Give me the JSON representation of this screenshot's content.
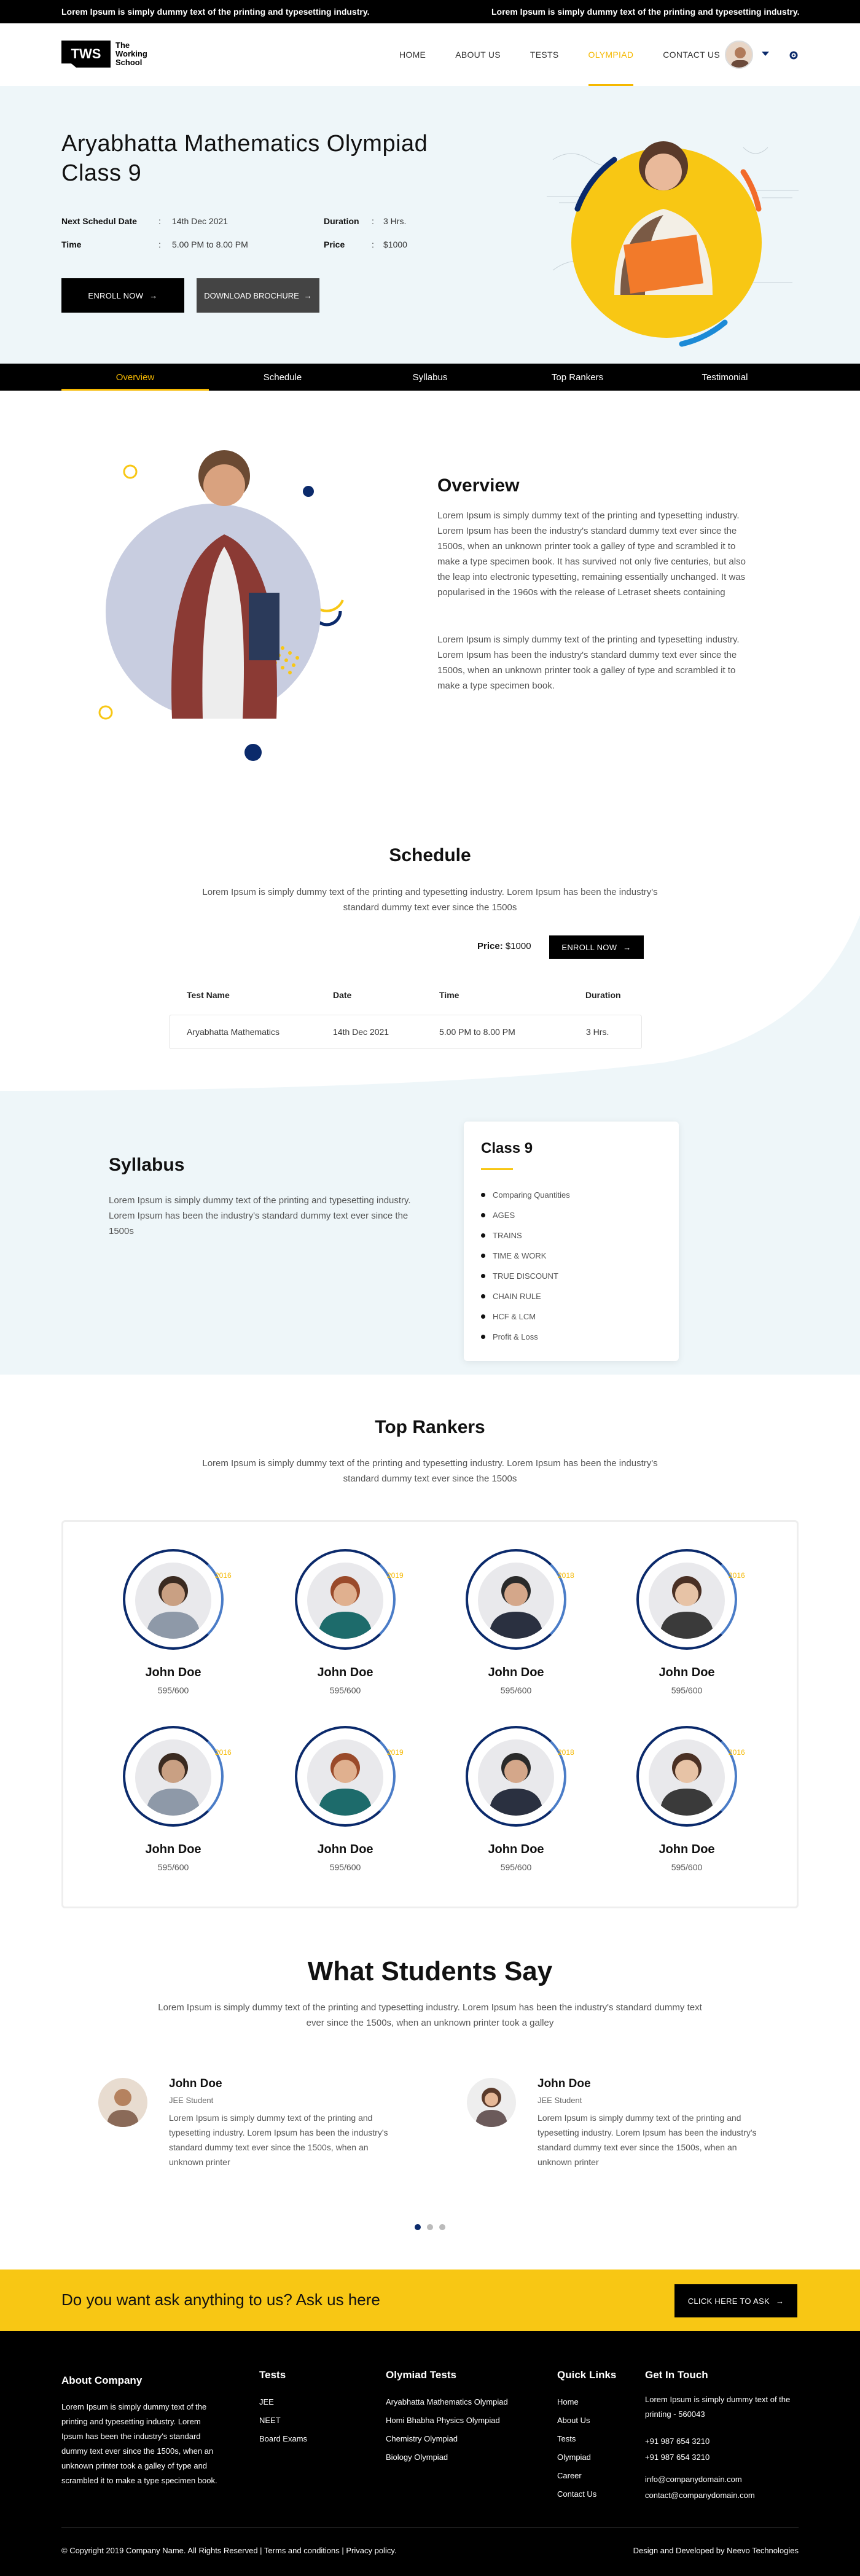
{
  "ticker": {
    "text": "Lorem Ipsum is simply dummy text of the printing and typesetting industry."
  },
  "header": {
    "logo_mark": "TWS",
    "logo_line1": "The",
    "logo_line2": "Working",
    "logo_line3": "School",
    "nav": [
      "HOME",
      "ABOUT US",
      "TESTS",
      "OLYMPIAD",
      "CONTACT US"
    ],
    "active_nav": "OLYMPIAD"
  },
  "hero": {
    "title": "Aryabhatta Mathematics Olympiad Class 9",
    "next_label": "Next Schedul Date",
    "next_value": "14th Dec 2021",
    "duration_label": "Duration",
    "duration_value": "3 Hrs.",
    "time_label": "Time",
    "time_value": "5.00 PM to 8.00 PM",
    "price_label": "Price",
    "price_value": "$1000",
    "enroll": "ENROLL NOW",
    "brochure": "DOWNLOAD BROCHURE"
  },
  "tabs": [
    "Overview",
    "Schedule",
    "Syllabus",
    "Top Rankers",
    "Testimonial"
  ],
  "overview": {
    "title": "Overview",
    "p1": "Lorem Ipsum is simply dummy text of the printing and typesetting industry. Lorem Ipsum has been the industry's standard dummy text ever since the 1500s, when an unknown printer took a galley of type and scrambled it to make a type specimen book. It has survived not only five centuries, but also the leap into electronic typesetting, remaining essentially unchanged. It was popularised in the 1960s with the release of Letraset sheets containing",
    "p2": "Lorem Ipsum is simply dummy text of the printing and typesetting industry. Lorem Ipsum has been the industry's standard dummy text ever since the 1500s, when an unknown printer took a galley of type and scrambled it to make a type specimen book."
  },
  "schedule": {
    "title": "Schedule",
    "desc": "Lorem Ipsum is simply dummy text of the printing and typesetting industry. Lorem Ipsum has been the industry's standard dummy text ever since the 1500s",
    "price_label": "Price:",
    "price_value": "$1000",
    "enroll": "ENROLL NOW",
    "headers": [
      "Test Name",
      "Date",
      "Time",
      "Duration"
    ],
    "row": [
      "Aryabhatta Mathematics",
      "14th Dec 2021",
      "5.00 PM to 8.00 PM",
      "3 Hrs."
    ]
  },
  "syllabus": {
    "title": "Syllabus",
    "desc": "Lorem Ipsum is simply dummy text of the printing and typesetting industry. Lorem Ipsum has been the industry's standard dummy text ever since the 1500s",
    "card_title": "Class 9",
    "items": [
      "Comparing Quantities",
      "AGES",
      "TRAINS",
      "TIME & WORK",
      "TRUE DISCOUNT",
      "CHAIN RULE",
      "HCF & LCM",
      "Profit & Loss"
    ]
  },
  "rankers": {
    "title": "Top Rankers",
    "desc": "Lorem Ipsum is simply dummy text of the printing and typesetting industry. Lorem Ipsum has been the industry's standard dummy text ever since the 1500s",
    "list": [
      {
        "name": "John Doe",
        "score": "595/600",
        "year": "2016"
      },
      {
        "name": "John Doe",
        "score": "595/600",
        "year": "2019"
      },
      {
        "name": "John Doe",
        "score": "595/600",
        "year": "2018"
      },
      {
        "name": "John Doe",
        "score": "595/600",
        "year": "2016"
      },
      {
        "name": "John Doe",
        "score": "595/600",
        "year": "2016"
      },
      {
        "name": "John Doe",
        "score": "595/600",
        "year": "2019"
      },
      {
        "name": "John Doe",
        "score": "595/600",
        "year": "2018"
      },
      {
        "name": "John Doe",
        "score": "595/600",
        "year": "2016"
      }
    ]
  },
  "testimonials": {
    "title": "What Students Say",
    "desc": "Lorem Ipsum is simply dummy text of the printing and typesetting industry. Lorem Ipsum has been the industry's standard dummy text ever since the 1500s, when an unknown printer took a galley",
    "items": [
      {
        "name": "John Doe",
        "role": "JEE Student",
        "text": "Lorem Ipsum is simply dummy text of the printing and typesetting industry. Lorem Ipsum has been the industry's standard dummy text ever since the 1500s, when an unknown printer"
      },
      {
        "name": "John Doe",
        "role": "JEE Student",
        "text": "Lorem Ipsum is simply dummy text of the printing and typesetting industry. Lorem Ipsum has been the industry's standard dummy text ever since the 1500s, when an unknown printer"
      }
    ]
  },
  "cta": {
    "text": "Do you want ask anything to us? Ask us here",
    "button": "CLICK HERE TO ASK"
  },
  "footer": {
    "about_title": "About Company",
    "about_text": "Lorem Ipsum is simply dummy text of the printing and typesetting industry. Lorem Ipsum has been the industry's standard dummy text ever since the 1500s, when an unknown printer took a galley of type and scrambled it to make a type specimen book.",
    "tests_title": "Tests",
    "tests": [
      "JEE",
      "NEET",
      "Board Exams"
    ],
    "olympiad_title": "Olymiad Tests",
    "olympiad": [
      "Aryabhatta Mathematics Olympiad",
      "Homi Bhabha Physics Olympiad",
      "Chemistry Olympiad",
      "Biology Olympiad"
    ],
    "links_title": "Quick Links",
    "links": [
      "Home",
      "About Us",
      "Tests",
      "Olympiad",
      "Career",
      "Contact Us"
    ],
    "touch_title": "Get In Touch",
    "address": "Lorem Ipsum is simply dummy text of the printing - 560043",
    "phone1": "+91 987 654 3210",
    "phone2": "+91 987 654 3210",
    "email1": "info@companydomain.com",
    "email2": "contact@companydomain.com",
    "copyright": "© Copyright 2019 Company Name. All Rights Reserved | Terms and conditions | Privacy policy.",
    "credit": "Design and Developed by Neevo Technologies"
  },
  "colors": {
    "accent": "#f8c714",
    "navy": "#0b2a6b",
    "dark": "#000000",
    "light_bg": "#eef6f9"
  }
}
